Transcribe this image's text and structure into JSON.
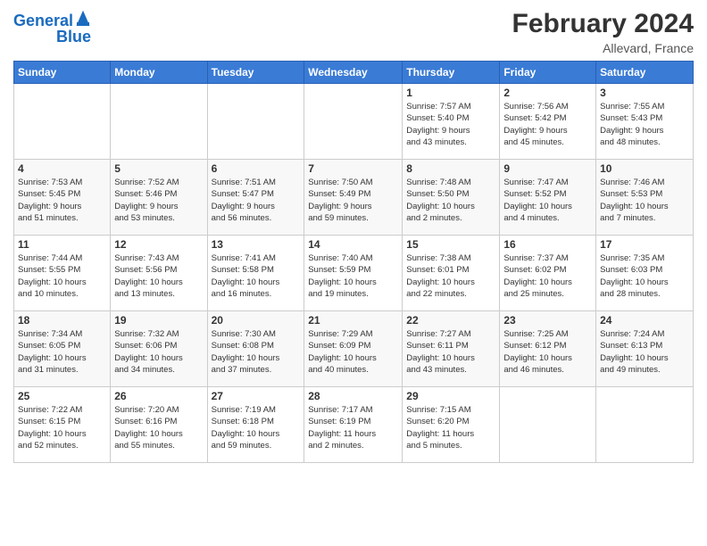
{
  "logo": {
    "line1": "General",
    "line2": "Blue"
  },
  "header": {
    "title": "February 2024",
    "subtitle": "Allevard, France"
  },
  "weekdays": [
    "Sunday",
    "Monday",
    "Tuesday",
    "Wednesday",
    "Thursday",
    "Friday",
    "Saturday"
  ],
  "weeks": [
    [
      {
        "day": "",
        "detail": ""
      },
      {
        "day": "",
        "detail": ""
      },
      {
        "day": "",
        "detail": ""
      },
      {
        "day": "",
        "detail": ""
      },
      {
        "day": "1",
        "detail": "Sunrise: 7:57 AM\nSunset: 5:40 PM\nDaylight: 9 hours\nand 43 minutes."
      },
      {
        "day": "2",
        "detail": "Sunrise: 7:56 AM\nSunset: 5:42 PM\nDaylight: 9 hours\nand 45 minutes."
      },
      {
        "day": "3",
        "detail": "Sunrise: 7:55 AM\nSunset: 5:43 PM\nDaylight: 9 hours\nand 48 minutes."
      }
    ],
    [
      {
        "day": "4",
        "detail": "Sunrise: 7:53 AM\nSunset: 5:45 PM\nDaylight: 9 hours\nand 51 minutes."
      },
      {
        "day": "5",
        "detail": "Sunrise: 7:52 AM\nSunset: 5:46 PM\nDaylight: 9 hours\nand 53 minutes."
      },
      {
        "day": "6",
        "detail": "Sunrise: 7:51 AM\nSunset: 5:47 PM\nDaylight: 9 hours\nand 56 minutes."
      },
      {
        "day": "7",
        "detail": "Sunrise: 7:50 AM\nSunset: 5:49 PM\nDaylight: 9 hours\nand 59 minutes."
      },
      {
        "day": "8",
        "detail": "Sunrise: 7:48 AM\nSunset: 5:50 PM\nDaylight: 10 hours\nand 2 minutes."
      },
      {
        "day": "9",
        "detail": "Sunrise: 7:47 AM\nSunset: 5:52 PM\nDaylight: 10 hours\nand 4 minutes."
      },
      {
        "day": "10",
        "detail": "Sunrise: 7:46 AM\nSunset: 5:53 PM\nDaylight: 10 hours\nand 7 minutes."
      }
    ],
    [
      {
        "day": "11",
        "detail": "Sunrise: 7:44 AM\nSunset: 5:55 PM\nDaylight: 10 hours\nand 10 minutes."
      },
      {
        "day": "12",
        "detail": "Sunrise: 7:43 AM\nSunset: 5:56 PM\nDaylight: 10 hours\nand 13 minutes."
      },
      {
        "day": "13",
        "detail": "Sunrise: 7:41 AM\nSunset: 5:58 PM\nDaylight: 10 hours\nand 16 minutes."
      },
      {
        "day": "14",
        "detail": "Sunrise: 7:40 AM\nSunset: 5:59 PM\nDaylight: 10 hours\nand 19 minutes."
      },
      {
        "day": "15",
        "detail": "Sunrise: 7:38 AM\nSunset: 6:01 PM\nDaylight: 10 hours\nand 22 minutes."
      },
      {
        "day": "16",
        "detail": "Sunrise: 7:37 AM\nSunset: 6:02 PM\nDaylight: 10 hours\nand 25 minutes."
      },
      {
        "day": "17",
        "detail": "Sunrise: 7:35 AM\nSunset: 6:03 PM\nDaylight: 10 hours\nand 28 minutes."
      }
    ],
    [
      {
        "day": "18",
        "detail": "Sunrise: 7:34 AM\nSunset: 6:05 PM\nDaylight: 10 hours\nand 31 minutes."
      },
      {
        "day": "19",
        "detail": "Sunrise: 7:32 AM\nSunset: 6:06 PM\nDaylight: 10 hours\nand 34 minutes."
      },
      {
        "day": "20",
        "detail": "Sunrise: 7:30 AM\nSunset: 6:08 PM\nDaylight: 10 hours\nand 37 minutes."
      },
      {
        "day": "21",
        "detail": "Sunrise: 7:29 AM\nSunset: 6:09 PM\nDaylight: 10 hours\nand 40 minutes."
      },
      {
        "day": "22",
        "detail": "Sunrise: 7:27 AM\nSunset: 6:11 PM\nDaylight: 10 hours\nand 43 minutes."
      },
      {
        "day": "23",
        "detail": "Sunrise: 7:25 AM\nSunset: 6:12 PM\nDaylight: 10 hours\nand 46 minutes."
      },
      {
        "day": "24",
        "detail": "Sunrise: 7:24 AM\nSunset: 6:13 PM\nDaylight: 10 hours\nand 49 minutes."
      }
    ],
    [
      {
        "day": "25",
        "detail": "Sunrise: 7:22 AM\nSunset: 6:15 PM\nDaylight: 10 hours\nand 52 minutes."
      },
      {
        "day": "26",
        "detail": "Sunrise: 7:20 AM\nSunset: 6:16 PM\nDaylight: 10 hours\nand 55 minutes."
      },
      {
        "day": "27",
        "detail": "Sunrise: 7:19 AM\nSunset: 6:18 PM\nDaylight: 10 hours\nand 59 minutes."
      },
      {
        "day": "28",
        "detail": "Sunrise: 7:17 AM\nSunset: 6:19 PM\nDaylight: 11 hours\nand 2 minutes."
      },
      {
        "day": "29",
        "detail": "Sunrise: 7:15 AM\nSunset: 6:20 PM\nDaylight: 11 hours\nand 5 minutes."
      },
      {
        "day": "",
        "detail": ""
      },
      {
        "day": "",
        "detail": ""
      }
    ]
  ]
}
